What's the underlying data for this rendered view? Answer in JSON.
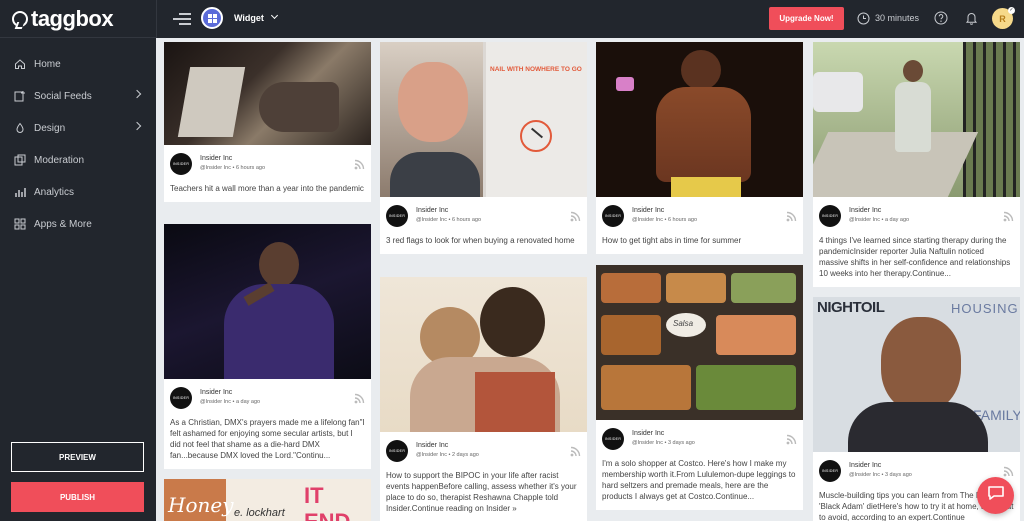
{
  "app": {
    "logo_text": "taggbox"
  },
  "sidebar": {
    "items": [
      {
        "label": "Home",
        "icon": "home-icon"
      },
      {
        "label": "Social Feeds",
        "icon": "add-feed-icon",
        "has_chevron": true
      },
      {
        "label": "Design",
        "icon": "palette-icon",
        "has_chevron": true
      },
      {
        "label": "Moderation",
        "icon": "moderation-icon"
      },
      {
        "label": "Analytics",
        "icon": "analytics-icon"
      },
      {
        "label": "Apps & More",
        "icon": "apps-icon"
      }
    ],
    "preview_label": "PREVIEW",
    "publish_label": "PUBLISH"
  },
  "topbar": {
    "widget_label": "Widget",
    "upgrade_label": "Upgrade Now!",
    "trial_time": "30 minutes",
    "avatar_initial": "R"
  },
  "posts": [
    {
      "author": "Insider Inc",
      "handle": "@Insider Inc",
      "time": "6 hours ago",
      "text": "Teachers hit a wall more than a year into the pandemic",
      "avatar_text": "INSIDER"
    },
    {
      "author": "Insider Inc",
      "handle": "@Insider Inc",
      "time": "a day ago",
      "text": "As a Christian, DMX's prayers made me a lifelong fan\"I felt ashamed for enjoying some secular artists, but I did not feel that shame as a die-hard DMX fan...because DMX loved the Lord.\"Continu...",
      "avatar_text": "INSIDER"
    },
    {
      "author": "Insider Inc",
      "handle": "@Insider Inc",
      "time": "6 hours ago",
      "text": "3 red flags to look for when buying a renovated home",
      "avatar_text": "INSIDER",
      "overlay_text": "NAIL WITH NOWHERE TO GO"
    },
    {
      "author": "Insider Inc",
      "handle": "@Insider Inc",
      "time": "2 days ago",
      "text": "How to support the BIPOC in your life after racist events happenBefore calling, assess whether it's your place to do so, therapist Reshawna Chapple told Insider.Continue reading on Insider »",
      "avatar_text": "INSIDER"
    },
    {
      "author": "Insider Inc",
      "handle": "@Insider Inc",
      "time": "6 hours ago",
      "text": "How to get tight abs in time for summer",
      "avatar_text": "INSIDER"
    },
    {
      "author": "Insider Inc",
      "handle": "@Insider Inc",
      "time": "3 days ago",
      "text": "I'm a solo shopper at Costco. Here's how I make my membership worth it.From Lululemon-dupe leggings to hard seltzers and premade meals, here are the products I always get at Costco.Continue...",
      "avatar_text": "INSIDER",
      "overlay_text": "Salsa"
    },
    {
      "author": "Insider Inc",
      "handle": "@Insider Inc",
      "time": "a day ago",
      "text": "4 things I've learned since starting therapy during the pandemicInsider reporter Julia Naftulin noticed massive shifts in her self-confidence and relationships 10 weeks into her therapy.Continue...",
      "avatar_text": "INSIDER"
    },
    {
      "author": "Insider Inc",
      "handle": "@Insider Inc",
      "time": "3 days ago",
      "text": "Muscle-building tips you can learn from The Rock's 'Black Adam' dietHere's how to try it at home, and what to avoid, according to an expert.Continue",
      "avatar_text": "INSIDER",
      "overlay_text": "NIGHTOIL HOUSING LAW FAMILY"
    },
    {
      "overlay_text": "Honey IT ENDS e. lockhart"
    }
  ]
}
